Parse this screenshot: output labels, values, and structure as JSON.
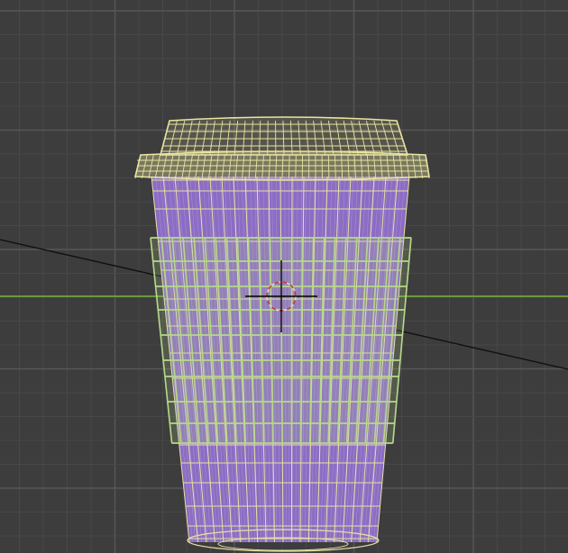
{
  "viewport": {
    "background_color": "#3d3d3d",
    "grid_minor_color": "#484848",
    "grid_major_color": "#575757",
    "horizon_axis_color": "#6a9a3a",
    "object_name": "cup-wireframe-model",
    "colors": {
      "lid": "#e8e4a0",
      "body_fill": "#8c6cc4",
      "body_wire": "#e4e0a4",
      "sleeve": "#b6d88a",
      "cursor_ring": "#c23b3b",
      "cursor_cross": "#000000",
      "diagonal_line": "#111111"
    }
  }
}
